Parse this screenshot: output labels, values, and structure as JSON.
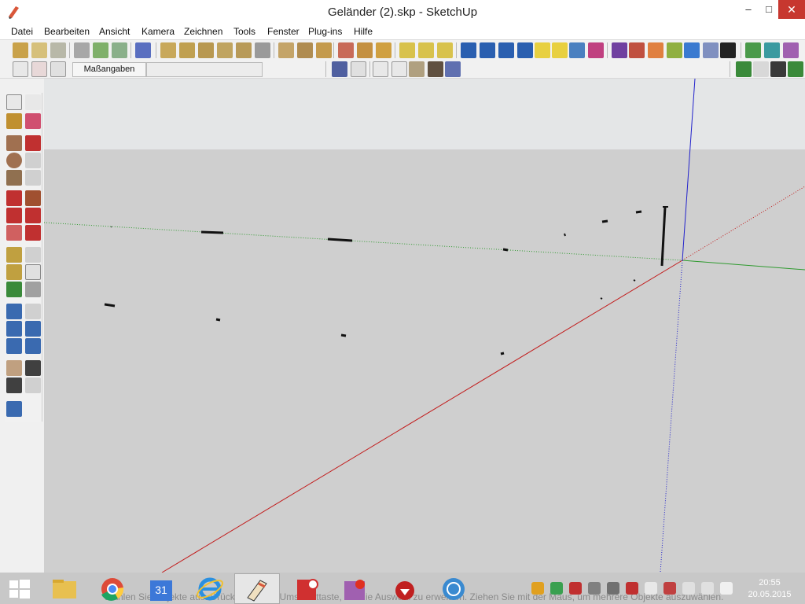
{
  "window": {
    "title": "Geländer (2).skp - SketchUp",
    "minimize": "–",
    "maximize": "□",
    "close": "✕"
  },
  "menu": [
    "Datei",
    "Bearbeiten",
    "Ansicht",
    "Kamera",
    "Zeichnen",
    "Tools",
    "Fenster",
    "Plug-ins",
    "Hilfe"
  ],
  "measurements": {
    "label": "Maßangaben",
    "value": ""
  },
  "status": {
    "text": "Wählen Sie Objekte aus. Drücken Sie die Umschalttaste, um die Auswahl zu erweitern. Ziehen Sie mit der Maus, um mehrere Objekte auszuwählen."
  },
  "taskbar": {
    "calendar_day": "31",
    "time": "20:55",
    "date": "20.05.2015"
  },
  "colors": {
    "sky": "#e4e6e7",
    "ground": "#cfcfcf",
    "red_axis": "#c21b1b",
    "green_axis": "#2f9a2f",
    "blue_axis": "#2222cc"
  }
}
